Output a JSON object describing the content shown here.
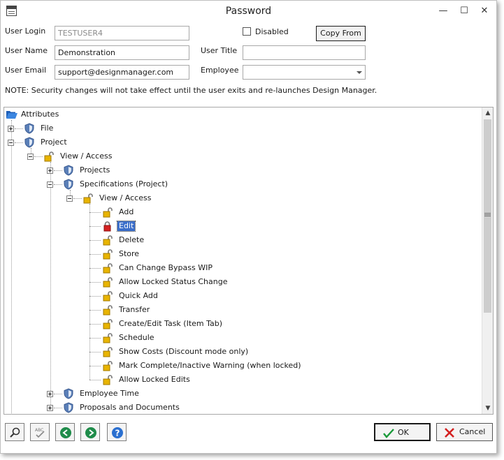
{
  "window": {
    "title": "Password"
  },
  "titlebar": {
    "minimize": "—",
    "maximize": "☐",
    "close": "✕"
  },
  "form": {
    "user_login_label": "User Login",
    "user_login_value": "TESTUSER4",
    "user_name_label": "User Name",
    "user_name_value": "Demonstration",
    "user_email_label": "User Email",
    "user_email_value": "support@designmanager.com",
    "disabled_label": "Disabled",
    "disabled_checked": false,
    "copy_from_label": "Copy From",
    "user_title_label": "User Title",
    "user_title_value": "",
    "employee_label": "Employee",
    "employee_value": ""
  },
  "note": "NOTE: Security changes will not take effect until the user exits and re-launches Design Manager.",
  "tree": {
    "root": "Attributes",
    "file": "File",
    "project": "Project",
    "project_view_access": "View / Access",
    "projects": "Projects",
    "specifications": "Specifications (Project)",
    "spec_view_access": "View / Access",
    "permissions": [
      "Add",
      "Edit",
      "Delete",
      "Store",
      "Can Change Bypass WIP",
      "Allow Locked Status Change",
      "Quick Add",
      "Transfer",
      "Create/Edit Task (Item Tab)",
      "Schedule",
      "Show Costs (Discount mode only)",
      "Mark Complete/Inactive Warning (when locked)",
      "Allow Locked Edits"
    ],
    "selected_permission": "Edit",
    "employee_time": "Employee Time",
    "proposals": "Proposals and Documents"
  },
  "buttons": {
    "ok": "OK",
    "cancel": "Cancel"
  },
  "colors": {
    "selection": "#3b6ec9",
    "lock_open": "#e8b400",
    "lock_closed": "#d42020",
    "shield": "#5a7fb8"
  }
}
